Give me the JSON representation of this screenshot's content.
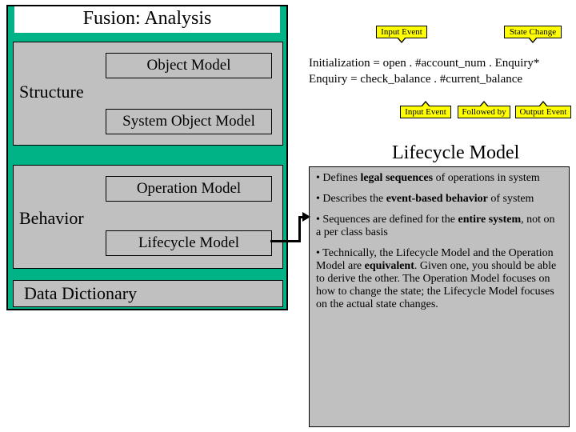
{
  "title": "Fusion: Analysis",
  "groups": {
    "structure": "Structure",
    "behavior": "Behavior",
    "data_dictionary": "Data Dictionary"
  },
  "subs": {
    "object_model": "Object Model",
    "system_object_model": "System Object Model",
    "operation_model": "Operation Model",
    "lifecycle_model": "Lifecycle Model"
  },
  "callouts": {
    "input_event": "Input Event",
    "state_change": "State Change",
    "input_event2": "Input Event",
    "followed_by": "Followed by",
    "output_event": "Output Event"
  },
  "equations": {
    "line1": "Initialization = open . #account_num . Enquiry*",
    "line2": "Enquiry = check_balance . #current_balance"
  },
  "right_heading": "Lifecycle Model",
  "bullets": {
    "b1_pre": "• Defines ",
    "b1_bold": "legal sequences",
    "b1_post": " of operations in system",
    "b2_pre": "• Describes the ",
    "b2_bold": "event-based behavior",
    "b2_post": " of system",
    "b3_pre": "• Sequences are defined for the ",
    "b3_bold": "entire system",
    "b3_post": ", not on a per class basis",
    "b4_pre": "• Technically, the Lifecycle Model and the Operation Model are ",
    "b4_bold": "equivalent",
    "b4_post": ". Given one, you should be able to derive the other. The Operation Model focuses on how to change the state; the Lifecycle Model focuses on the actual state changes."
  }
}
